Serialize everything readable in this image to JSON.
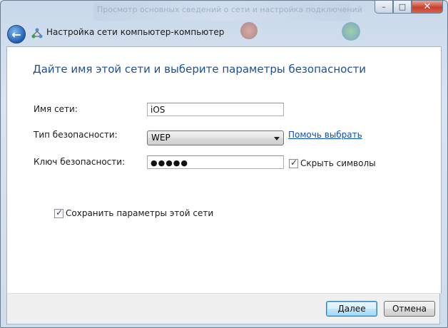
{
  "window": {
    "title": "Настройка сети компьютер-компьютер",
    "background_caption": "Просмотр основных сведений о сети и настройка подключений"
  },
  "caption_buttons": {
    "minimize": "–",
    "maximize": "□",
    "close": "✕"
  },
  "icons": {
    "back": "back-arrow-icon",
    "network": "network-wizard-icon"
  },
  "heading": "Дайте имя этой сети и выберите параметры безопасности",
  "form": {
    "network_name_label": "Имя сети:",
    "network_name_value": "iOS",
    "security_type_label": "Тип безопасности:",
    "security_type_value": "WEP",
    "help_link": "Помочь выбрать",
    "key_label": "Ключ безопасности:",
    "key_value": "●●●●●",
    "hide_chars_label": "Скрыть символы",
    "hide_chars_checked": true,
    "save_settings_label": "Сохранить параметры этой сети",
    "save_settings_checked": true
  },
  "footer": {
    "next_label": "Далее",
    "cancel_label": "Отмена"
  },
  "colors": {
    "heading": "#1e4f96",
    "link": "#0a4fc3",
    "close_button": "#c7402e"
  }
}
